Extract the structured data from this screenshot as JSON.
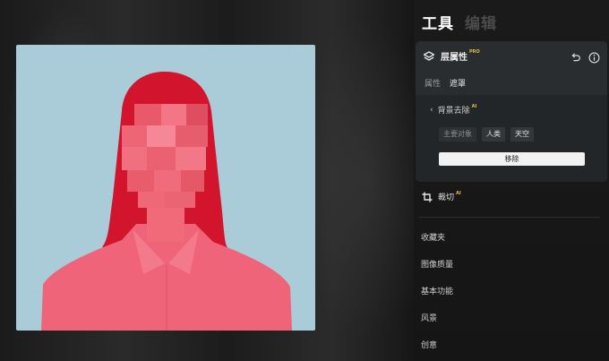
{
  "header": {
    "tab_tools": "工具",
    "tab_edit": "编辑"
  },
  "layer_panel": {
    "title": "层属性",
    "pro_badge": "PRO",
    "tabs": [
      {
        "label": "属性",
        "active": false
      },
      {
        "label": "遮罩",
        "active": true
      }
    ],
    "background_removal": {
      "label": "背景去除",
      "ai_badge": "AI",
      "subjects": [
        {
          "label": "主要对象",
          "selected": false
        },
        {
          "label": "人类",
          "selected": true
        },
        {
          "label": "天空",
          "selected": true
        }
      ],
      "remove_label": "移除"
    }
  },
  "crop": {
    "label": "裁切",
    "ai_badge": "AI"
  },
  "menu": [
    {
      "label": "收藏夹"
    },
    {
      "label": "图像质量"
    },
    {
      "label": "基本功能"
    },
    {
      "label": "风景"
    },
    {
      "label": "创意"
    }
  ],
  "colors": {
    "photo_background": "#a9ccd8",
    "subject_overlay": "#ee5a6c",
    "hair_overlay": "#d2142c",
    "panel_card": "#2a2d2f",
    "remove_button": "#f2f2f2",
    "badge": "#e1b94a"
  },
  "icons": {
    "layers": "layers-icon",
    "undo": "undo-icon",
    "info": "info-icon",
    "back": "chevron-left-icon",
    "crop": "crop-icon"
  }
}
